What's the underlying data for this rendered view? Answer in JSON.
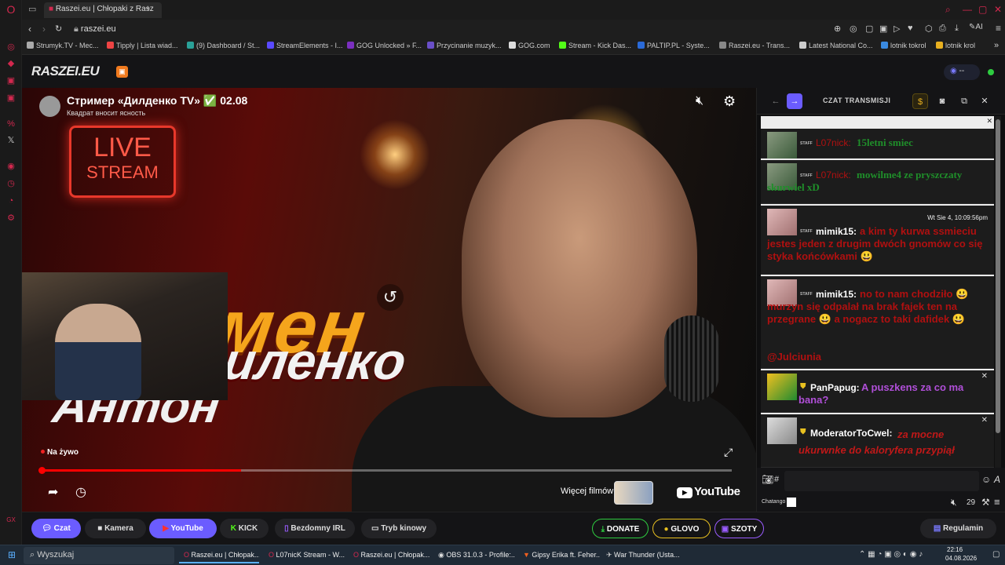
{
  "browser": {
    "tabs": [
      {
        "label": "Raszei.eu | Chłopaki z Rasz"
      }
    ],
    "url": "raszei.eu",
    "new_tab": "+",
    "bookmarks": [
      "Strumyk.TV - Mec...",
      "Tipply | Lista wiad...",
      "(9) Dashboard / St...",
      "StreamElements - I...",
      "GOG Unlocked » F...",
      "Przycinanie muzyk...",
      "GOG.com",
      "Stream - Kick Das...",
      "PALTIP.PL - Syste...",
      "Raszei.eu - Trans...",
      "Latest National Co...",
      "lotnik tokrol",
      "lotnik krol"
    ],
    "ai_label": "AI"
  },
  "site": {
    "logo": "RASZEI.EU",
    "viewers": "--"
  },
  "player": {
    "title": "Стример «Дилденко TV» ✅ 02.08",
    "subtitle": "Квадрат вносит ясность",
    "thumb_texts": {
      "live": "LIVE",
      "stream": "STREAM",
      "big1": "Шоумен",
      "big2": "Диленко",
      "big3": "Антон"
    },
    "live_label": "Na żywo",
    "more_videos": "Więcej filmów",
    "youtube": "YouTube",
    "progress_fraction": 0.29
  },
  "chat": {
    "header": "CZAT TRANSMISJI",
    "staff_badge": "STAFF",
    "messages": [
      {
        "nick": "L07nick:",
        "text": "15letni smiec",
        "nick_color": "#b01010",
        "text_color": "#1f8f2a"
      },
      {
        "nick": "L07nick:",
        "text": "mowilme4 ze pryszczaty skurwiel xD",
        "nick_color": "#b01010",
        "text_color": "#1f8f2a"
      },
      {
        "nick": "mimik15:",
        "text": "a kim ty kurwa ssmieciu jestes jeden z drugim dwóch gnomów co się styka końcówkami 😃",
        "timestamp": "Wt Sie 4, 10:09:56pm",
        "text_color": "#b01010"
      },
      {
        "nick": "mimik15:",
        "text": "no to nam chodziło 😃 murzyn się odpalał na brak fajek ten na przegrane 😃 a nogacz to taki dafidek 😃",
        "mention": "@Julciunia",
        "text_color": "#b01010"
      },
      {
        "nick": "PanPapug:",
        "text": "A puszkens za co ma bana?",
        "text_color": "#b04fd8"
      },
      {
        "nick": "ModeratorToCwel:",
        "text": "za mocne ukurwnke do kaloryfera przypiął",
        "text_color": "#c01818"
      }
    ],
    "input_hash": "#",
    "footer_label": "Chatango",
    "count": "29"
  },
  "nav": {
    "buttons": [
      "Czat",
      "Kamera",
      "YouTube",
      "KICK",
      "Bezdomny IRL",
      "Tryb kinowy",
      "DONATE",
      "GLOVO",
      "SZOTY",
      "Regulamin"
    ]
  },
  "taskbar": {
    "search": "Wyszukaj",
    "items": [
      "Raszei.eu | Chłopak...",
      "L07nicK Stream - W...",
      "Raszei.eu | Chłopak...",
      "OBS 31.0.3 - Profile:...",
      "Gipsy Erika ft. Feher...",
      "War Thunder (Usta..."
    ],
    "time": "22:16",
    "date": "04.08.2026"
  },
  "colors": {
    "accent_opera": "#d2284e",
    "accent_purple": "#6b5cff",
    "live_red": "#ff0000"
  }
}
